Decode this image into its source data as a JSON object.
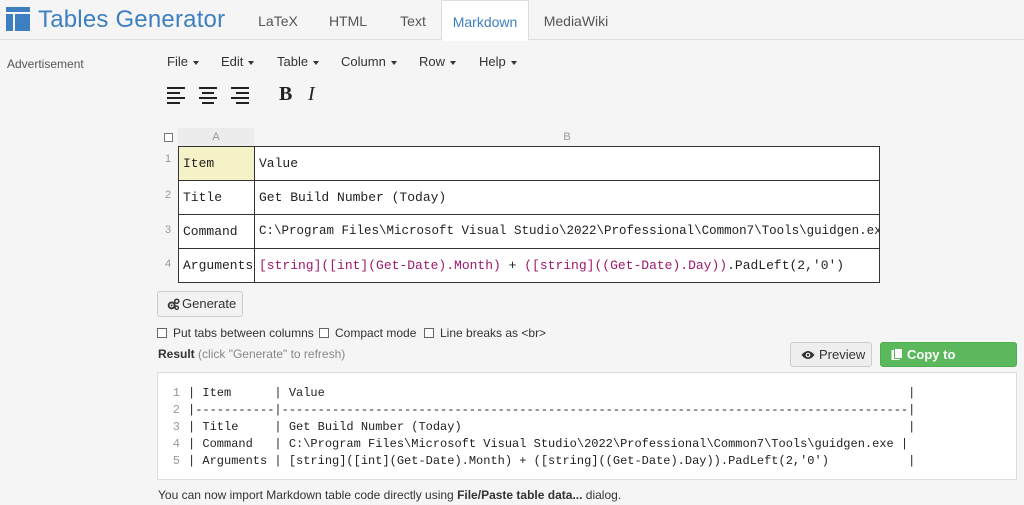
{
  "brand": {
    "name": "Tables Generator",
    "accent": "#3e7fc1"
  },
  "tabs": [
    {
      "label": "LaTeX"
    },
    {
      "label": "HTML"
    },
    {
      "label": "Text"
    },
    {
      "label": "Markdown",
      "active": true
    },
    {
      "label": "MediaWiki"
    }
  ],
  "sidebar": {
    "advertisement": "Advertisement"
  },
  "menu": [
    {
      "label": "File"
    },
    {
      "label": "Edit"
    },
    {
      "label": "Table"
    },
    {
      "label": "Column"
    },
    {
      "label": "Row"
    },
    {
      "label": "Help"
    }
  ],
  "toolbar": {
    "icons": [
      "align-left-icon",
      "align-center-icon",
      "align-right-icon"
    ],
    "bold": "B",
    "italic": "I"
  },
  "grid": {
    "column_headers": [
      "A",
      "B"
    ],
    "row_headers": [
      "1",
      "2",
      "3",
      "4"
    ],
    "rows": [
      {
        "a": "Item",
        "b": "Value"
      },
      {
        "a": "Title",
        "b": "Get Build Number (Today)"
      },
      {
        "a": "Command",
        "b": "C:\\Program Files\\Microsoft Visual Studio\\2022\\Professional\\Common7\\Tools\\guidgen.exe"
      },
      {
        "a": "Arguments",
        "b_parts": [
          "[string]([int](Get-Date).Month)",
          " + ",
          "([string]((Get-Date).Day))",
          ".PadLeft(2,'0')"
        ]
      }
    ]
  },
  "buttons": {
    "generate": "Generate",
    "preview": "Preview",
    "copy": "Copy to clipboard"
  },
  "options": [
    {
      "label": "Put tabs between columns",
      "checked": false
    },
    {
      "label": "Compact mode",
      "checked": false
    },
    {
      "label": "Line breaks as <br>",
      "checked": false
    }
  ],
  "result": {
    "label": "Result",
    "hint": "(click \"Generate\" to refresh)"
  },
  "code_lines": [
    {
      "num": "1",
      "text": "| Item      | Value                                                                                 |"
    },
    {
      "num": "2",
      "text": "|-----------|---------------------------------------------------------------------------------------|"
    },
    {
      "num": "3",
      "text": "| Title     | Get Build Number (Today)                                                              |"
    },
    {
      "num": "4",
      "text": "| Command   | C:\\Program Files\\Microsoft Visual Studio\\2022\\Professional\\Common7\\Tools\\guidgen.exe |"
    },
    {
      "num": "5",
      "text": "| Arguments | [string]([int](Get-Date).Month) + ([string]((Get-Date).Day)).PadLeft(2,'0')           |"
    }
  ],
  "footer": {
    "prefix": "You can now import Markdown table code directly using ",
    "bold": "File/Paste table data...",
    "suffix": " dialog."
  }
}
